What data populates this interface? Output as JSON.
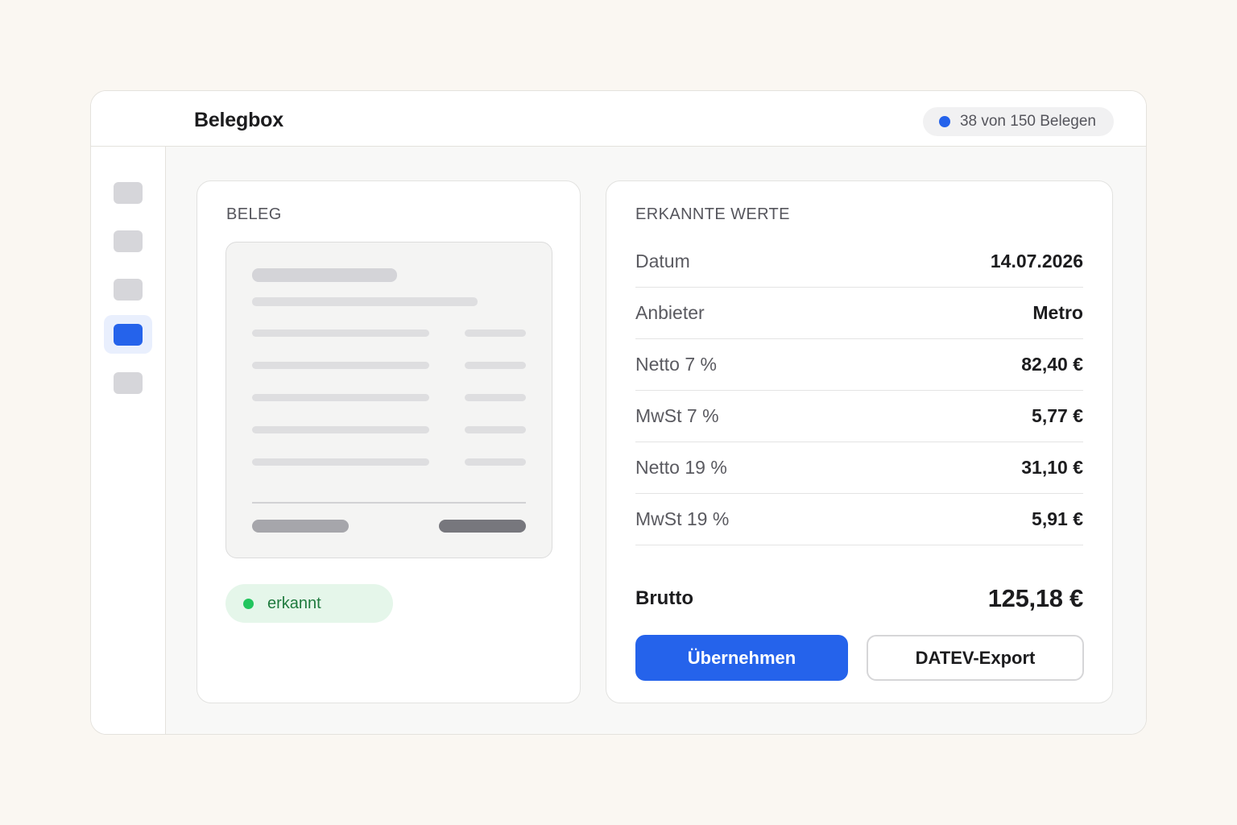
{
  "header": {
    "title": "Belegbox",
    "counter_text": "38 von 150 Belegen",
    "counter_dot_color": "#2563eb"
  },
  "sidebar": {
    "items": [
      {
        "name": "nav-item-1",
        "active": false
      },
      {
        "name": "nav-item-2",
        "active": false
      },
      {
        "name": "nav-item-3",
        "active": false
      },
      {
        "name": "nav-item-4",
        "active": true
      },
      {
        "name": "nav-item-5",
        "active": false
      }
    ],
    "accent_color": "#2563eb"
  },
  "receipt_panel": {
    "label": "BELEG",
    "status_label": "erkannt",
    "status_color": "#22c55e"
  },
  "values_panel": {
    "label": "ERKANNTE WERTE",
    "rows": [
      {
        "label": "Datum",
        "value": "14.07.2026"
      },
      {
        "label": "Anbieter",
        "value": "Metro"
      },
      {
        "label": "Netto 7 %",
        "value": "82,40 €"
      },
      {
        "label": "MwSt 7 %",
        "value": "5,77 €"
      },
      {
        "label": "Netto 19 %",
        "value": "31,10 €"
      },
      {
        "label": "MwSt 19 %",
        "value": "5,91 €"
      }
    ],
    "total_label": "Brutto",
    "total_value": "125,18 €",
    "primary_button": "Übernehmen",
    "secondary_button": "DATEV-Export"
  }
}
